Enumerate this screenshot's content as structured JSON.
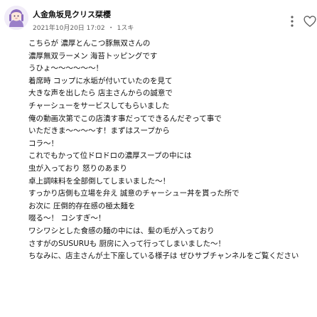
{
  "comment": {
    "author": "人金魚坂見クリス栞樱",
    "timestamp": "2021年10月20日 17:02",
    "separator": "・",
    "edit_mark": "1スキ",
    "more_icon": "more-vert-icon",
    "heart_icon": "heart-outline-icon",
    "lines": [
      "こちらが 濃厚とんこつ豚無双さんの",
      "濃厚無双ラーメン 海苔トッピングです",
      "うひょ～～～～～～！",
      "着席時 コップに水垢が付いていたのを見て",
      "大きな声を出したら 店主さんからの誠意で",
      "チャーシューをサービスしてもらいました",
      "俺の動画次第でこの店潰す事だってできるんだぞって事で",
      "いただきま～～～～す！まずはスープから",
      "コラ～！",
      "これでもかって位ドロドロの濃厚スープの中には",
      "虫が入っており 怒りのあまり",
      "卓上調味料を全部倒してしまいました～！",
      "すっかり店側も立場を弁え 誠意のチャーシュー丼を貰った所で",
      "お次に 圧倒的存在感の極太麺を",
      "啜る～！ コシすぎ～！",
      "ワシワシとした食感の麺の中には、髪の毛が入っており",
      "さすがのSUSURUも 厨房に入って行ってしまいました～！",
      "ちなみに、店主さんが土下座している様子は ぜひサブチャンネルをご覧ください"
    ]
  }
}
